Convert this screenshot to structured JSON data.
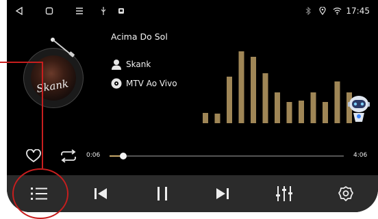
{
  "status_bar": {
    "time": "17:45"
  },
  "track": {
    "title": "Acima Do Sol",
    "artist": "Skank",
    "album": "MTV Ao Vivo",
    "album_art_text": "Skank"
  },
  "playback": {
    "current_time": "0:06",
    "total_time": "4:06",
    "progress": 0.024
  },
  "equalizer": {
    "bar_levels": [
      14,
      13,
      62,
      95,
      88,
      66,
      41,
      28,
      30,
      41,
      28,
      55,
      41
    ]
  },
  "colors": {
    "accent": "#c8a96a",
    "background": "#000000",
    "control_bar": "#2b2b2b",
    "annotation": "#c81e1e"
  },
  "icons": [
    "back-icon",
    "home-icon",
    "menu-icon",
    "usb-icon",
    "notification-icon",
    "bluetooth-icon",
    "location-icon",
    "wifi-icon",
    "person-icon",
    "disc-icon",
    "heart-icon",
    "repeat-icon",
    "playlist-icon",
    "previous-icon",
    "pause-icon",
    "next-icon",
    "equalizer-icon",
    "settings-icon",
    "robot-icon"
  ]
}
